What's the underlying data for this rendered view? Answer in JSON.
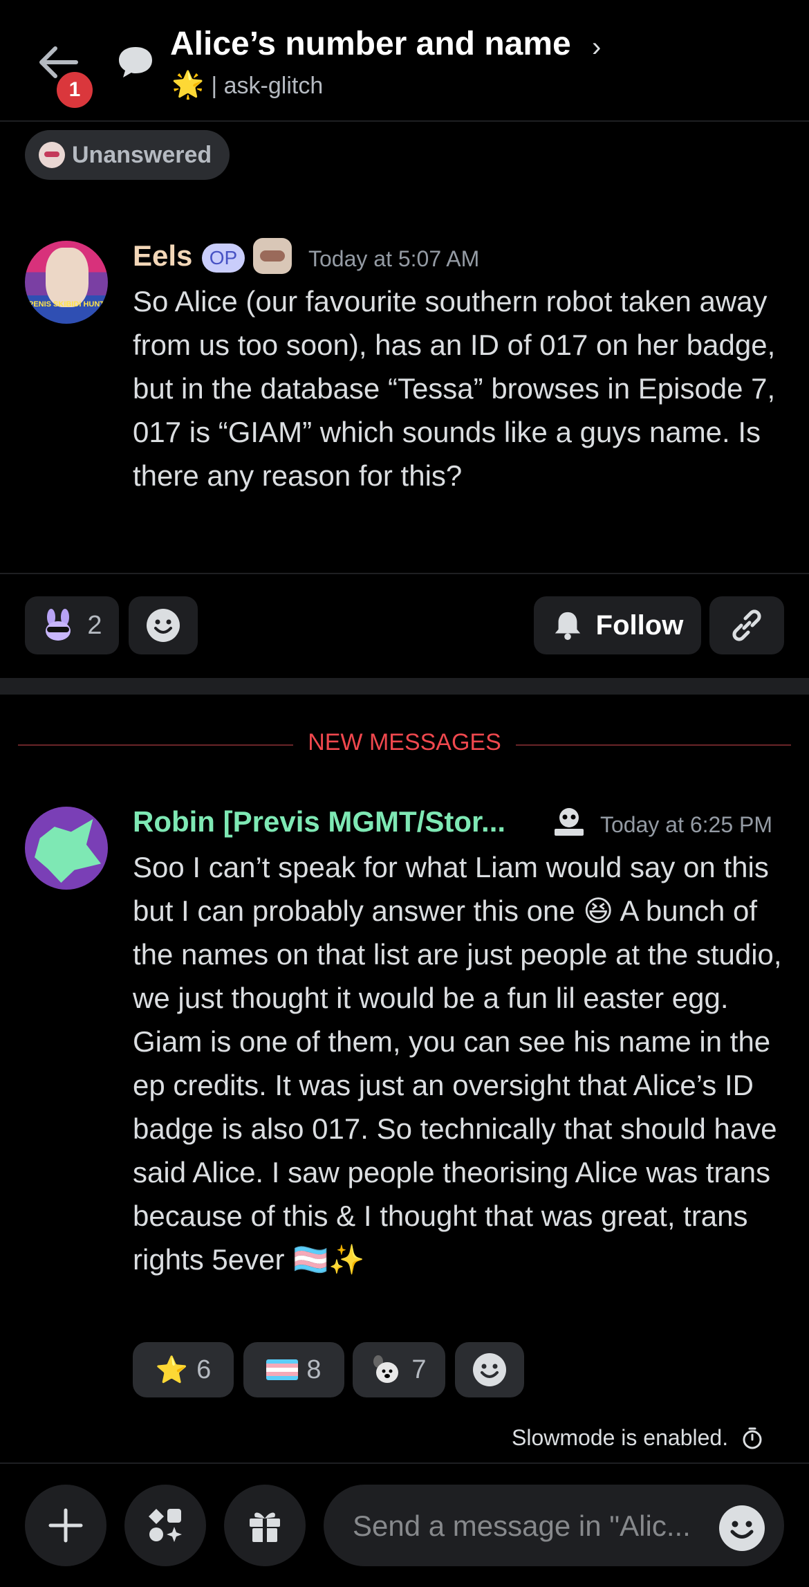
{
  "header": {
    "title": "Alice’s number and name",
    "channel": "ask-glitch",
    "channel_separator": "|",
    "back_badge_count": "1"
  },
  "tag": {
    "label": "Unanswered"
  },
  "op_message": {
    "author": "Eels",
    "op_badge": "OP",
    "avatar_caption": "PENIS SKIBIDI HUNT",
    "timestamp": "Today at 5:07 AM",
    "text": "So Alice (our favourite southern robot taken away from us too soon), has an ID of 017 on her badge, but in the database “Tessa” browses in Episode 7, 017 is “GIAM” which sounds like a guys name. Is there any reason for this?"
  },
  "thread_actions": {
    "reaction_count": "2",
    "follow_label": "Follow"
  },
  "divider": {
    "label": "NEW MESSAGES"
  },
  "reply_message": {
    "author": "Robin [Previs MGMT/Stor...",
    "timestamp": "Today at 6:25 PM",
    "text": "Soo I can’t speak for what Liam would say on this but I can probably answer this one 😆 A bunch of the names on that list are just people at the studio, we just thought it would be a fun lil easter egg. Giam is one of them, you can see his name in the ep credits. It was just an oversight that Alice’s ID badge is also 017. So technically that should have said Alice. I saw people theorising Alice was trans because of this & I thought that was great, trans rights 5ever 🏳️‍⚧️✨",
    "reactions": [
      {
        "emoji": "⭐",
        "count": "6"
      },
      {
        "emoji": "trans-flag",
        "count": "8"
      },
      {
        "emoji": "custom-dog",
        "count": "7"
      }
    ]
  },
  "slowmode": {
    "text": "Slowmode is enabled."
  },
  "composer": {
    "placeholder": "Send a message in \"Alic..."
  },
  "colors": {
    "background": "#000000",
    "accent_red": "#f0484e",
    "eels_name": "#f3d7b8",
    "robin_name": "#7ee8b4"
  }
}
